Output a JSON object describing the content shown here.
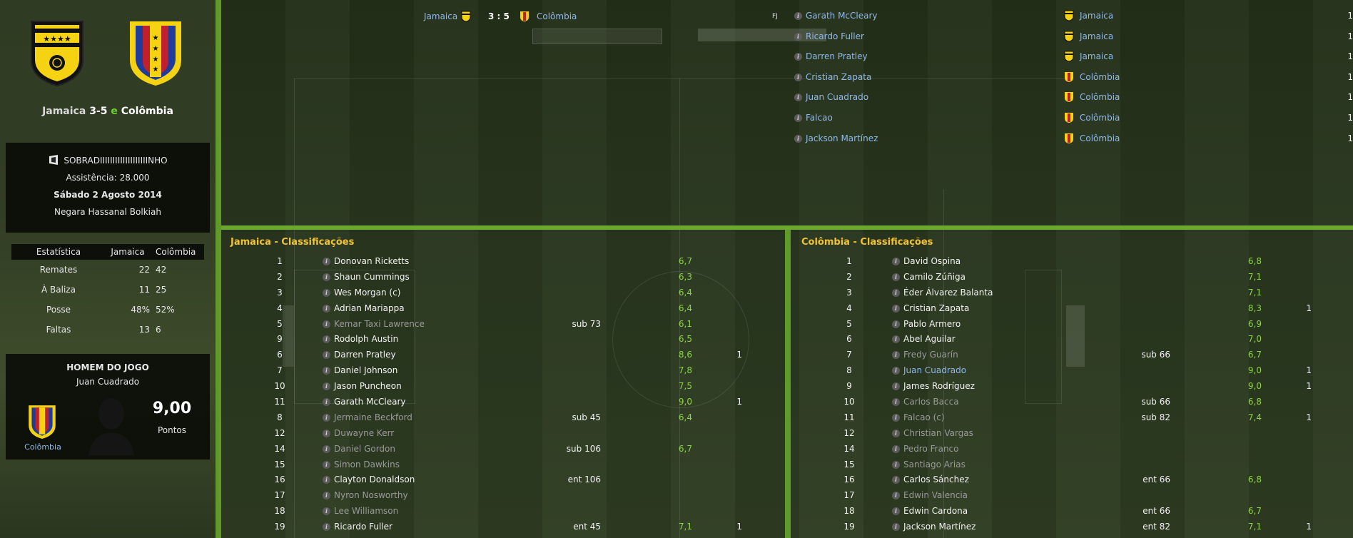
{
  "colors": {
    "jamaica_yellow": "#f5d312",
    "colombia_yellow": "#f5d312",
    "rating_green": "#8fd14a",
    "title_gold": "#f1c232",
    "link_blue": "#8fb8e8"
  },
  "match": {
    "home": "Jamaica",
    "home_score": "3",
    "dash": "-",
    "away_score": "5",
    "e": "e",
    "away": "Colômbia",
    "scoreline": "3 : 5",
    "fj": "FJ"
  },
  "info": {
    "stadium": "SOBRADIIIIIIIIIIIIIIIIIIINHO",
    "attendance": "Assistência: 28.000",
    "date": "Sábado 2 Agosto 2014",
    "referee": "Negara Hassanal Bolkiah"
  },
  "stats": {
    "header": [
      "Estatística",
      "Jamaica",
      "Colômbia"
    ],
    "rows": [
      {
        "label": "Remates",
        "home": "22",
        "away": "42"
      },
      {
        "label": "À Baliza",
        "home": "11",
        "away": "25"
      },
      {
        "label": "Posse",
        "home": "48%",
        "away": "52%"
      },
      {
        "label": "Faltas",
        "home": "13",
        "away": "6"
      }
    ]
  },
  "motm": {
    "title": "HOMEM DO JOGO",
    "player": "Juan Cuadrado",
    "team": "Colômbia",
    "score": "9,00",
    "score_label": "Pontos"
  },
  "scorers": [
    {
      "name": "Garath McCleary",
      "team": "Jamaica",
      "goals": "1"
    },
    {
      "name": "Ricardo Fuller",
      "team": "Jamaica",
      "goals": "1"
    },
    {
      "name": "Darren Pratley",
      "team": "Jamaica",
      "goals": "1"
    },
    {
      "name": "Cristian Zapata",
      "team": "Colômbia",
      "goals": "1"
    },
    {
      "name": "Juan Cuadrado",
      "team": "Colômbia",
      "goals": "1"
    },
    {
      "name": "Falcao",
      "team": "Colômbia",
      "goals": "1"
    },
    {
      "name": "Jackson Martínez",
      "team": "Colômbia",
      "goals": "1"
    }
  ],
  "jamaica_ratings": {
    "title": "Jamaica - Classificações",
    "rows": [
      {
        "num": "1",
        "name": "Donovan Ricketts",
        "sub": "",
        "rating": "6,7",
        "goals": "",
        "dim": false
      },
      {
        "num": "2",
        "name": "Shaun Cummings",
        "sub": "",
        "rating": "6,3",
        "goals": "",
        "dim": false
      },
      {
        "num": "3",
        "name": "Wes Morgan (c)",
        "sub": "",
        "rating": "6,4",
        "goals": "",
        "dim": false
      },
      {
        "num": "4",
        "name": "Adrian Mariappa",
        "sub": "",
        "rating": "6,4",
        "goals": "",
        "dim": false
      },
      {
        "num": "5",
        "name": "Kemar Taxi Lawrence",
        "sub": "sub 73",
        "rating": "6,1",
        "goals": "",
        "dim": true
      },
      {
        "num": "9",
        "name": "Rodolph Austin",
        "sub": "",
        "rating": "6,5",
        "goals": "",
        "dim": false
      },
      {
        "num": "6",
        "name": "Darren Pratley",
        "sub": "",
        "rating": "8,6",
        "goals": "1",
        "dim": false
      },
      {
        "num": "7",
        "name": "Daniel Johnson",
        "sub": "",
        "rating": "7,8",
        "goals": "",
        "dim": false
      },
      {
        "num": "10",
        "name": "Jason Puncheon",
        "sub": "",
        "rating": "7,5",
        "goals": "",
        "dim": false
      },
      {
        "num": "11",
        "name": "Garath McCleary",
        "sub": "",
        "rating": "9,0",
        "goals": "1",
        "dim": false
      },
      {
        "num": "8",
        "name": "Jermaine Beckford",
        "sub": "sub 45",
        "rating": "6,4",
        "goals": "",
        "dim": true
      },
      {
        "num": "12",
        "name": "Duwayne Kerr",
        "sub": "",
        "rating": "",
        "goals": "",
        "dim": true
      },
      {
        "num": "14",
        "name": "Daniel Gordon",
        "sub": "sub 106",
        "rating": "6,7",
        "goals": "",
        "dim": true
      },
      {
        "num": "15",
        "name": "Simon Dawkins",
        "sub": "",
        "rating": "",
        "goals": "",
        "dim": true
      },
      {
        "num": "16",
        "name": "Clayton Donaldson",
        "sub": "ent 106",
        "rating": "",
        "goals": "",
        "dim": false
      },
      {
        "num": "17",
        "name": "Nyron Nosworthy",
        "sub": "",
        "rating": "",
        "goals": "",
        "dim": true
      },
      {
        "num": "18",
        "name": "Lee Williamson",
        "sub": "",
        "rating": "",
        "goals": "",
        "dim": true
      },
      {
        "num": "19",
        "name": "Ricardo Fuller",
        "sub": "ent 45",
        "rating": "7,1",
        "goals": "1",
        "dim": false
      }
    ]
  },
  "colombia_ratings": {
    "title": "Colômbia - Classificações",
    "rows": [
      {
        "num": "1",
        "name": "David Ospina",
        "sub": "",
        "rating": "6,8",
        "goals": "",
        "dim": false
      },
      {
        "num": "2",
        "name": "Camilo Zúñiga",
        "sub": "",
        "rating": "7,1",
        "goals": "",
        "dim": false
      },
      {
        "num": "3",
        "name": "Éder Álvarez Balanta",
        "sub": "",
        "rating": "7,1",
        "goals": "",
        "dim": false
      },
      {
        "num": "4",
        "name": "Cristian Zapata",
        "sub": "",
        "rating": "8,3",
        "goals": "1",
        "dim": false
      },
      {
        "num": "5",
        "name": "Pablo Armero",
        "sub": "",
        "rating": "6,9",
        "goals": "",
        "dim": false
      },
      {
        "num": "6",
        "name": "Abel Aguilar",
        "sub": "",
        "rating": "7,0",
        "goals": "",
        "dim": false
      },
      {
        "num": "7",
        "name": "Fredy Guarín",
        "sub": "sub 66",
        "rating": "6,7",
        "goals": "",
        "dim": true
      },
      {
        "num": "8",
        "name": "Juan Cuadrado",
        "sub": "",
        "rating": "9,0",
        "goals": "1",
        "dim": false,
        "link": true
      },
      {
        "num": "9",
        "name": "James Rodríguez",
        "sub": "",
        "rating": "9,0",
        "goals": "1",
        "dim": false
      },
      {
        "num": "10",
        "name": "Carlos Bacca",
        "sub": "sub 66",
        "rating": "6,8",
        "goals": "",
        "dim": true
      },
      {
        "num": "11",
        "name": "Falcao (c)",
        "sub": "sub 82",
        "rating": "7,4",
        "goals": "1",
        "dim": true
      },
      {
        "num": "12",
        "name": "Christian Vargas",
        "sub": "",
        "rating": "",
        "goals": "",
        "dim": true
      },
      {
        "num": "14",
        "name": "Pedro Franco",
        "sub": "",
        "rating": "",
        "goals": "",
        "dim": true
      },
      {
        "num": "15",
        "name": "Santiago Arias",
        "sub": "",
        "rating": "",
        "goals": "",
        "dim": true
      },
      {
        "num": "16",
        "name": "Carlos Sánchez",
        "sub": "ent 66",
        "rating": "6,8",
        "goals": "",
        "dim": false
      },
      {
        "num": "17",
        "name": "Edwin Valencia",
        "sub": "",
        "rating": "",
        "goals": "",
        "dim": true
      },
      {
        "num": "18",
        "name": "Edwin Cardona",
        "sub": "ent 66",
        "rating": "6,7",
        "goals": "",
        "dim": false
      },
      {
        "num": "19",
        "name": "Jackson Martínez",
        "sub": "ent 82",
        "rating": "7,1",
        "goals": "1",
        "dim": false
      }
    ]
  }
}
